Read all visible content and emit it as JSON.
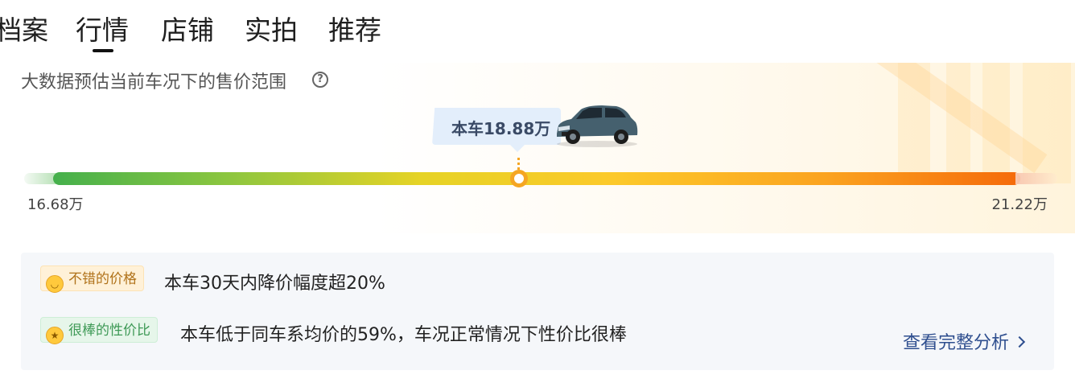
{
  "tabs": [
    {
      "label": "档案"
    },
    {
      "label": "行情"
    },
    {
      "label": "店铺"
    },
    {
      "label": "实拍"
    },
    {
      "label": "推荐"
    }
  ],
  "active_tab": "行情",
  "estimate": {
    "title": "大数据预估当前车况下的售价范围",
    "help_icon": "question-circle-icon",
    "current_price_label": "本车18.88万",
    "current_price": 18.88,
    "min_label": "16.68万",
    "max_label": "21.22万",
    "min": 16.68,
    "max": 21.22,
    "marker_fraction": 0.484,
    "bar_colors": [
      "#45b04c",
      "#e6d326",
      "#fcc92a",
      "#f56a0a"
    ]
  },
  "analysis": {
    "items": [
      {
        "tag": "不错的价格",
        "icon": "smile-emoji-icon",
        "text": "本车30天内降价幅度超20%"
      },
      {
        "tag": "很棒的性价比",
        "icon": "star-eyes-emoji-icon",
        "text": "本车低于同车系均价的59%，车况正常情况下性价比很棒"
      }
    ],
    "link_label": "查看完整分析"
  },
  "colors": {
    "accent_orange": "#f5a623",
    "link_blue": "#2f4f8f",
    "bubble_bg": "#e3eefb"
  }
}
